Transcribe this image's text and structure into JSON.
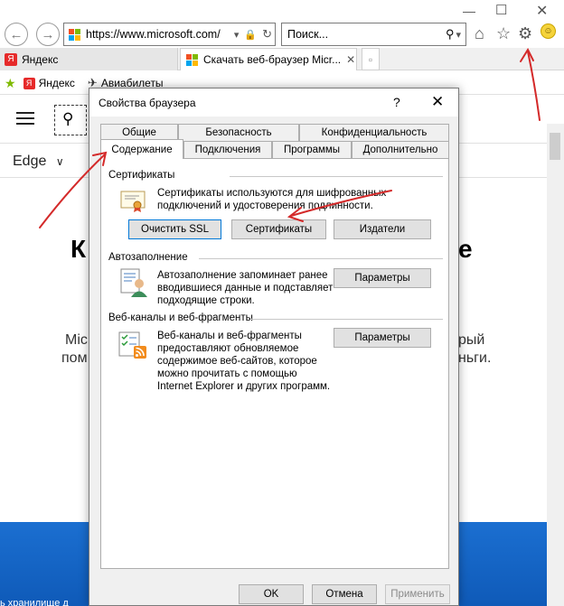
{
  "browser": {
    "url_prefix": "https://www.",
    "url_host": "microsoft.com",
    "url_suffix": "/",
    "search_placeholder": "Поиск...",
    "tabs": [
      {
        "label": "Яндекс"
      },
      {
        "label": "Скачать веб-браузер Micr..."
      }
    ],
    "favorites": [
      {
        "label": "Яндекс"
      },
      {
        "label": "Авиабилеты"
      }
    ]
  },
  "page": {
    "edge_label": "Edge",
    "partial_heading_left": "К",
    "partial_heading_right": "е",
    "partial_text_left_1": "Mic",
    "partial_text_left_2": "пом",
    "partial_text_right_1": "рый",
    "partial_text_right_2": "ньги.",
    "bottom_partial": "ь хранилище д"
  },
  "dialog": {
    "title": "Свойства браузера",
    "help_glyph": "?",
    "close_glyph": "✕",
    "tabs_top": [
      "Общие",
      "Безопасность",
      "Конфиденциальность"
    ],
    "tabs_bottom": [
      "Содержание",
      "Подключения",
      "Программы",
      "Дополнительно"
    ],
    "certificates": {
      "title": "Сертификаты",
      "desc_1": "Сертификаты используются для шифрованных",
      "desc_2": "подключений и удостоверения подлинности.",
      "btn_clear_ssl": "Очистить SSL",
      "btn_certificates": "Сертификаты",
      "btn_publishers": "Издатели"
    },
    "autocomplete": {
      "title": "Автозаполнение",
      "desc_1": "Автозаполнение запоминает ранее",
      "desc_2": "вводившиеся данные и подставляет",
      "desc_3": "подходящие строки.",
      "btn_settings": "Параметры"
    },
    "feeds": {
      "title": "Веб-каналы и веб-фрагменты",
      "desc_1": "Веб-каналы и веб-фрагменты",
      "desc_2": "предоставляют обновляемое",
      "desc_3": "содержимое веб-сайтов, которое",
      "desc_4": "можно прочитать с помощью",
      "desc_5": "Internet Explorer и других программ.",
      "btn_settings": "Параметры"
    },
    "footer": {
      "ok": "OK",
      "cancel": "Отмена",
      "apply": "Применить"
    }
  },
  "colors": {
    "annotation_red": "#d42a2a",
    "focus_blue": "#0078d7",
    "band_blue": "#1b6fd1"
  }
}
